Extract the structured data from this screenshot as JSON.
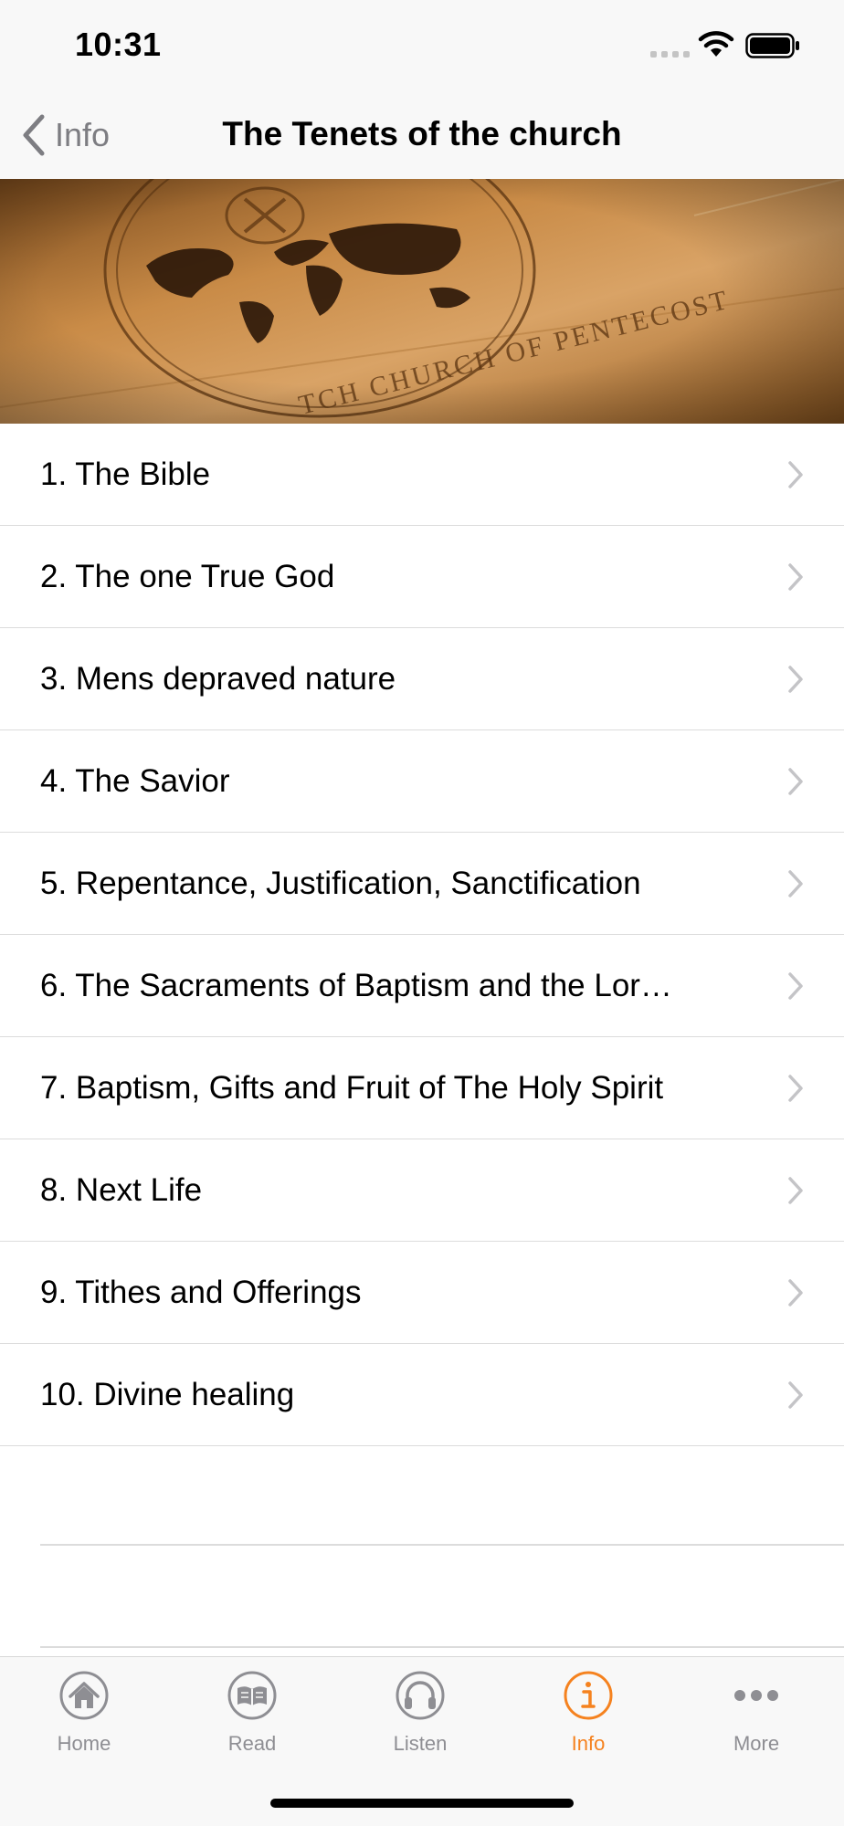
{
  "status_bar": {
    "time": "10:31"
  },
  "nav": {
    "back_label": "Info",
    "title": "The Tenets of the church"
  },
  "header_image": {
    "caption": "TCH CHURCH OF PENTECOST"
  },
  "tenets": [
    {
      "label": "1. The Bible"
    },
    {
      "label": "2. The one True God"
    },
    {
      "label": "3. Mens depraved nature"
    },
    {
      "label": "4. The Savior"
    },
    {
      "label": "5. Repentance, Justification, Sanctification"
    },
    {
      "label": "6. The Sacraments of Baptism and the Lor…"
    },
    {
      "label": "7. Baptism, Gifts and Fruit of The Holy Spirit"
    },
    {
      "label": "8. Next Life"
    },
    {
      "label": "9. Tithes and Offerings"
    },
    {
      "label": "10. Divine healing"
    }
  ],
  "tab_bar": {
    "tabs": [
      {
        "label": "Home",
        "icon": "home-icon",
        "active": false
      },
      {
        "label": "Read",
        "icon": "book-icon",
        "active": false
      },
      {
        "label": "Listen",
        "icon": "headphones-icon",
        "active": false
      },
      {
        "label": "Info",
        "icon": "info-icon",
        "active": true
      },
      {
        "label": "More",
        "icon": "more-icon",
        "active": false
      }
    ]
  },
  "colors": {
    "accent": "#f5821f",
    "inactive": "#8e8e93",
    "bar_bg": "#f8f8f8",
    "separator": "#dcdcdc"
  }
}
